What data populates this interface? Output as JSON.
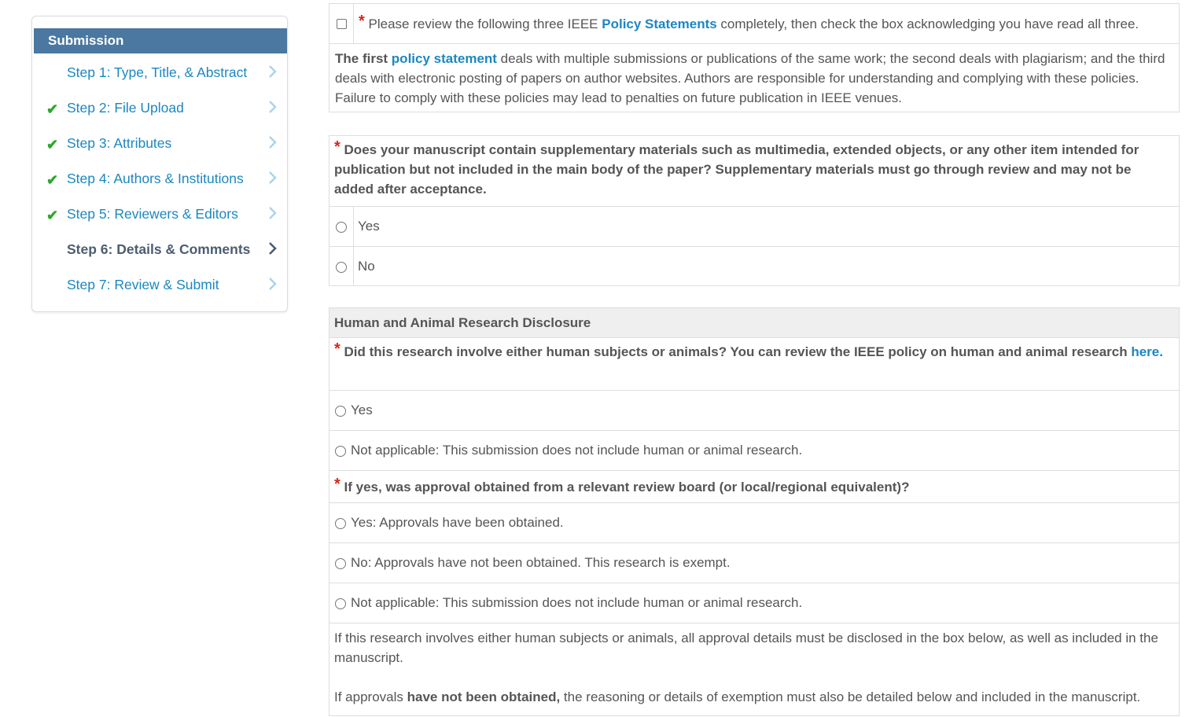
{
  "sidebar": {
    "title": "Submission",
    "steps": [
      {
        "label": "Step 1: Type, Title, & Abstract",
        "completed": false,
        "active": false
      },
      {
        "label": "Step 2: File Upload",
        "completed": true,
        "active": false
      },
      {
        "label": "Step 3: Attributes",
        "completed": true,
        "active": false
      },
      {
        "label": "Step 4: Authors & Institutions",
        "completed": true,
        "active": false
      },
      {
        "label": "Step 5: Reviewers & Editors",
        "completed": true,
        "active": false
      },
      {
        "label": "Step 6: Details & Comments",
        "completed": false,
        "active": true
      },
      {
        "label": "Step 7: Review & Submit",
        "completed": false,
        "active": false
      }
    ]
  },
  "policy": {
    "required_mark": "*",
    "ack_prefix": "Please review the following three IEEE ",
    "ack_link": "Policy Statements",
    "ack_suffix": " completely, then check the box acknowledging you have read all three.",
    "desc_first": "The first ",
    "desc_link": "policy statement",
    "desc_rest": " deals with multiple submissions or publications of the same work; the second deals with plagiarism; and the third deals with electronic posting of papers on author websites. Authors are responsible for understanding and complying with these policies. Failure to comply with these policies may lead to penalties on future publication in IEEE venues."
  },
  "supplementary": {
    "required_mark": "*",
    "question": "Does your manuscript contain supplementary materials such as multimedia, extended objects, or any other item intended for publication but not included in the main body of the paper? Supplementary materials must go through review and may not be added after acceptance.",
    "options": [
      "Yes",
      "No"
    ]
  },
  "research": {
    "header": "Human and Animal Research Disclosure",
    "required_mark": "*",
    "q1": "Did this research involve either human subjects or animals? You can review the IEEE policy on human and animal research",
    "q1_link": "here.",
    "q1_options": [
      "Yes",
      "Not applicable: This submission does not include human or animal research."
    ],
    "q2": "If yes, was approval obtained from a relevant review board (or local/regional equivalent)?",
    "q2_options": [
      "Yes: Approvals have been obtained.",
      "No: Approvals have not been obtained. This research is exempt.",
      "Not applicable: This submission does not include human or animal research."
    ],
    "note1": "If this research involves either human subjects or animals, all approval details must be disclosed in the box below, as well as included in the manuscript.",
    "note2_prefix": "If approvals ",
    "note2_bold": "have not been obtained,",
    "note2_suffix": " the reasoning or details of exemption must also be detailed below and included in the manuscript."
  },
  "colors": {
    "header_bg": "#4a78a0",
    "link": "#1b87c2",
    "check": "#2aa82a",
    "required": "#d9261c"
  }
}
